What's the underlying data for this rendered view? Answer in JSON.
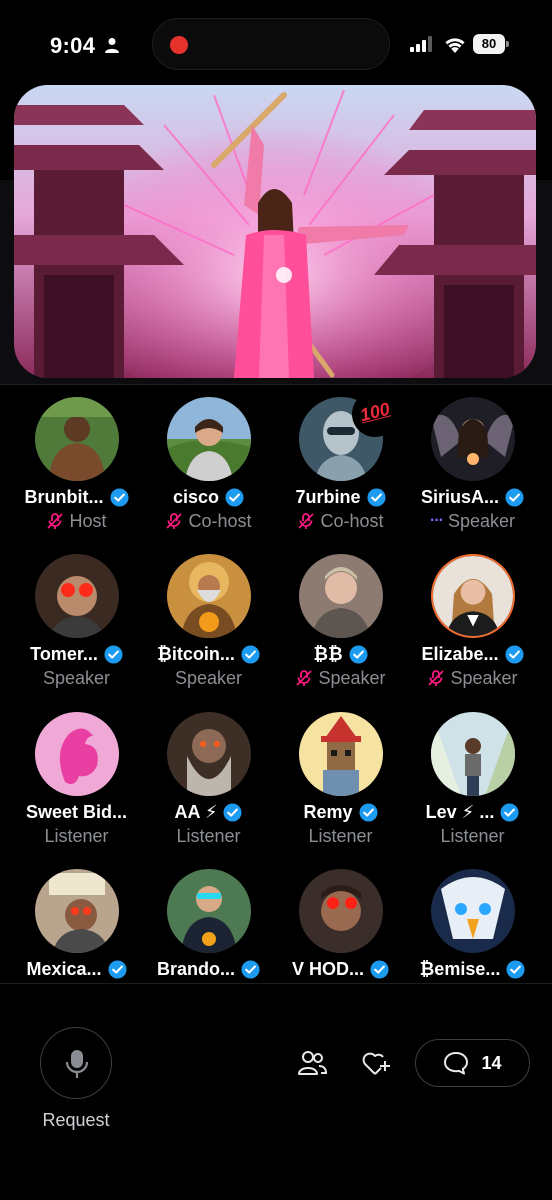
{
  "status_bar": {
    "time": "9:04",
    "battery": "80"
  },
  "participants": [
    {
      "name": "Brunbit...",
      "role": "Host",
      "verified": true,
      "mic": "muted"
    },
    {
      "name": "cisco",
      "role": "Co-host",
      "verified": true,
      "mic": "muted"
    },
    {
      "name": "7urbine",
      "role": "Co-host",
      "verified": true,
      "mic": "muted",
      "reaction": "100"
    },
    {
      "name": "SiriusA...",
      "role": "Speaker",
      "verified": true,
      "mic": "speaking"
    },
    {
      "name": "Tomer...",
      "role": "Speaker",
      "verified": true,
      "mic": "none"
    },
    {
      "name": "₿itcoin...",
      "role": "Speaker",
      "verified": true,
      "mic": "none"
    },
    {
      "name": "₿₿",
      "role": "Speaker",
      "verified": true,
      "mic": "muted"
    },
    {
      "name": "Elizabe...",
      "role": "Speaker",
      "verified": true,
      "mic": "muted"
    },
    {
      "name": "Sweet Bid...",
      "role": "Listener",
      "verified": false,
      "mic": "none"
    },
    {
      "name": "AA ⚡",
      "role": "Listener",
      "verified": true,
      "mic": "none"
    },
    {
      "name": "Remy",
      "role": "Listener",
      "verified": true,
      "mic": "none"
    },
    {
      "name": "Lev ⚡ ...",
      "role": "Listener",
      "verified": true,
      "mic": "none"
    },
    {
      "name": "Mexica...",
      "role": "",
      "verified": true,
      "mic": "none"
    },
    {
      "name": "Brando...",
      "role": "",
      "verified": true,
      "mic": "none"
    },
    {
      "name": "V HOD...",
      "role": "",
      "verified": true,
      "mic": "none"
    },
    {
      "name": "₿emise...",
      "role": "",
      "verified": true,
      "mic": "none"
    }
  ],
  "controls": {
    "request_label": "Request",
    "comment_count": "14",
    "icons": {
      "request": "microphone-icon",
      "people": "people-icon",
      "heart": "heart-plus-icon",
      "comment": "comment-icon"
    }
  },
  "colors": {
    "background": "#000000",
    "verified": "#1d9bf0",
    "muted_mic": "#f91880",
    "role_text": "#8b8f94",
    "speaking_dots": "#7d6bff"
  }
}
